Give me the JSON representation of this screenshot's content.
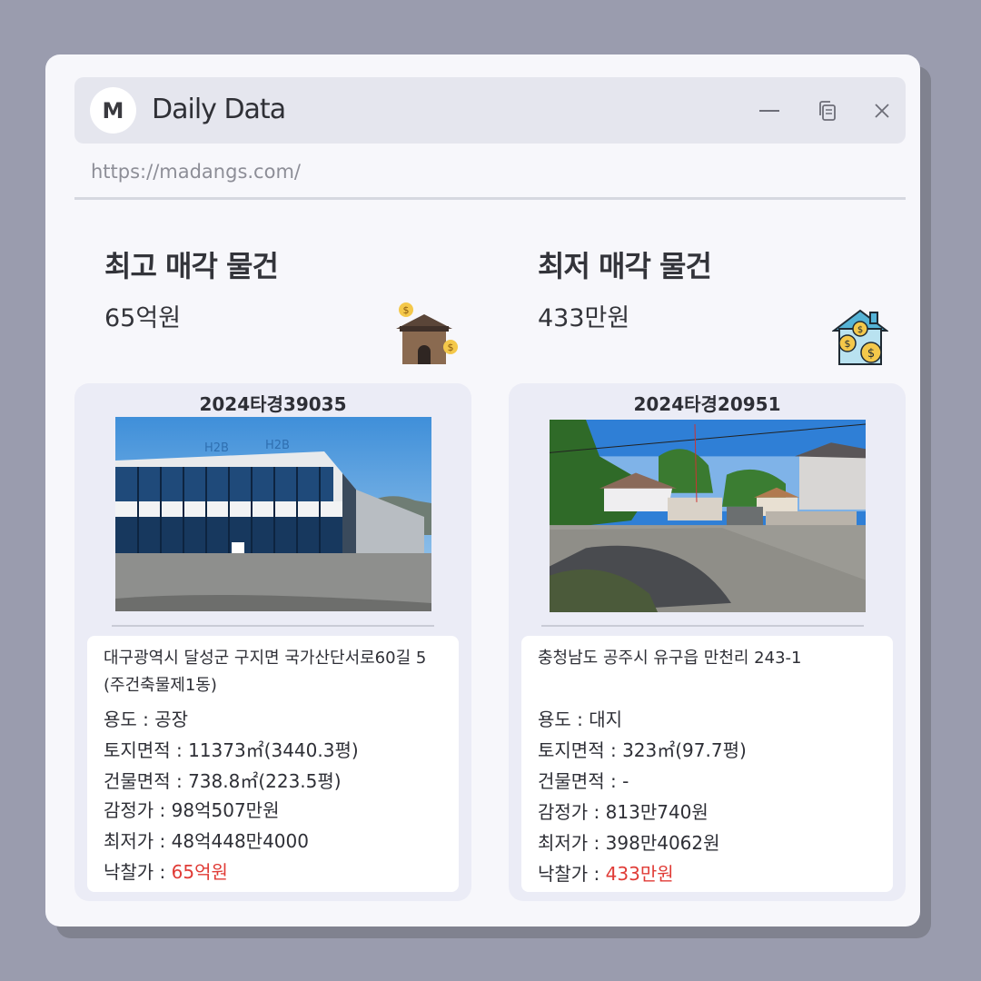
{
  "window": {
    "logo_letter": "M",
    "title": "Daily Data",
    "url": "https://madangs.com/",
    "controls": {
      "minimize": "minimize-icon",
      "copy": "copy-icon",
      "close": "close-icon"
    }
  },
  "colors": {
    "accent_red": "#e03b36",
    "window_bg": "#f7f7fb",
    "card_bg": "#ebecf6",
    "backdrop": "#9a9cae"
  },
  "left": {
    "heading": "최고 매각 물건",
    "price": "65억원",
    "icon": "house-with-coins-icon",
    "case_no": "2024타경39035",
    "photo": "factory-building-photo",
    "address": "대구광역시 달성군 구지면 국가산단서로60길 5 (주건축물제1동)",
    "specs": {
      "use_label": "용도 : ",
      "use": "공장",
      "land_label": "토지면적 : ",
      "land": "11373㎡(3440.3평)",
      "building_label": "건물면적 : ",
      "building": "738.8㎡(223.5평)",
      "appraisal_label": "감정가 : ",
      "appraisal": "98억507만원",
      "minimum_label": "최저가 : ",
      "minimum": "48억448만4000",
      "winning_label": "낙찰가 : ",
      "winning": "65억원"
    }
  },
  "right": {
    "heading": "최저 매각 물건",
    "price": "433만원",
    "icon": "blue-house-coins-icon",
    "case_no": "2024타경20951",
    "photo": "rural-house-yard-photo",
    "address": "충청남도 공주시 유구읍 만천리 243-1",
    "specs": {
      "use_label": "용도 : ",
      "use": "대지",
      "land_label": "토지면적 : ",
      "land": "323㎡(97.7평)",
      "building_label": "건물면적 : ",
      "building": "-",
      "appraisal_label": "감정가 : ",
      "appraisal": "813만740원",
      "minimum_label": "최저가 : ",
      "minimum": "398만4062원",
      "winning_label": "낙찰가 : ",
      "winning": "433만원"
    }
  }
}
